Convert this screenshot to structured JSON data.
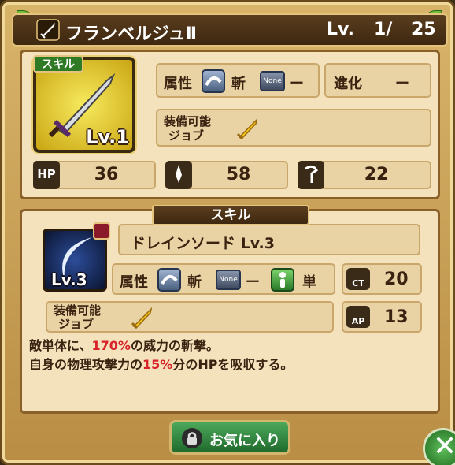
{
  "weapon": {
    "name": "フランベルジュⅡ",
    "lv_label": "Lv.",
    "level_current": "1/",
    "level_max": "25"
  },
  "item_card": {
    "skill_tag": "スキル",
    "level": "Lv.1"
  },
  "attributes": {
    "attr_label": "属性",
    "attr_value": "斬",
    "none_badge": "None",
    "none_value": "ー",
    "evolve_label": "進化",
    "evolve_value": "ー",
    "job_label_1": "装備可能",
    "job_label_2": "ジョブ"
  },
  "stats": {
    "hp_label": "HP",
    "hp": "36",
    "atk": "58",
    "mag": "22"
  },
  "skill": {
    "header": "スキル",
    "name": "ドレインソード Lv.3",
    "level": "Lv.3",
    "attr_label": "属性",
    "attr_value": "斬",
    "none_badge": "None",
    "none_value": "ー",
    "target_value": "単",
    "ct_label": "CT",
    "ct": "20",
    "ap_label": "AP",
    "ap": "13",
    "job_label_1": "装備可能",
    "job_label_2": "ジョブ",
    "desc_line1_a": "敵単体に、",
    "desc_line1_pct": "170%",
    "desc_line1_b": "の威力の斬撃。",
    "desc_line2_a": "自身の物理攻撃力の",
    "desc_line2_pct": "15%",
    "desc_line2_b": "分のHPを吸収する。"
  },
  "buttons": {
    "favorite": "お気に入り",
    "close_icon": "close-x-icon"
  },
  "colors": {
    "frame": "#b98d44",
    "accent_red": "#d8232a",
    "button_green": "#2f8a3c"
  }
}
